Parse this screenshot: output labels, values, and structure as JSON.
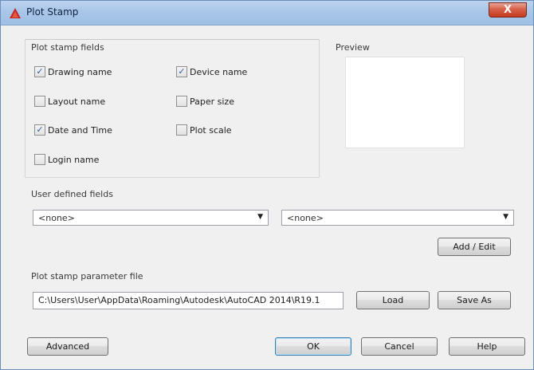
{
  "window": {
    "title": "Plot Stamp",
    "close": "X"
  },
  "fields_group": {
    "label": "Plot stamp fields",
    "items": [
      {
        "label": "Drawing name",
        "checked": true
      },
      {
        "label": "Device name",
        "checked": true
      },
      {
        "label": "Layout name",
        "checked": false
      },
      {
        "label": "Paper size",
        "checked": false
      },
      {
        "label": "Date and Time",
        "checked": true
      },
      {
        "label": "Plot scale",
        "checked": false
      },
      {
        "label": "Login name",
        "checked": false
      }
    ]
  },
  "preview": {
    "label": "Preview"
  },
  "user_fields": {
    "label": "User defined fields",
    "combo1": "<none>",
    "combo2": "<none>",
    "add_edit": "Add / Edit"
  },
  "param_file": {
    "label": "Plot stamp parameter file",
    "path": "C:\\Users\\User\\AppData\\Roaming\\Autodesk\\AutoCAD 2014\\R19.1",
    "load": "Load",
    "save_as": "Save As"
  },
  "footer": {
    "advanced": "Advanced",
    "ok": "OK",
    "cancel": "Cancel",
    "help": "Help"
  },
  "check_glyph": "✓"
}
